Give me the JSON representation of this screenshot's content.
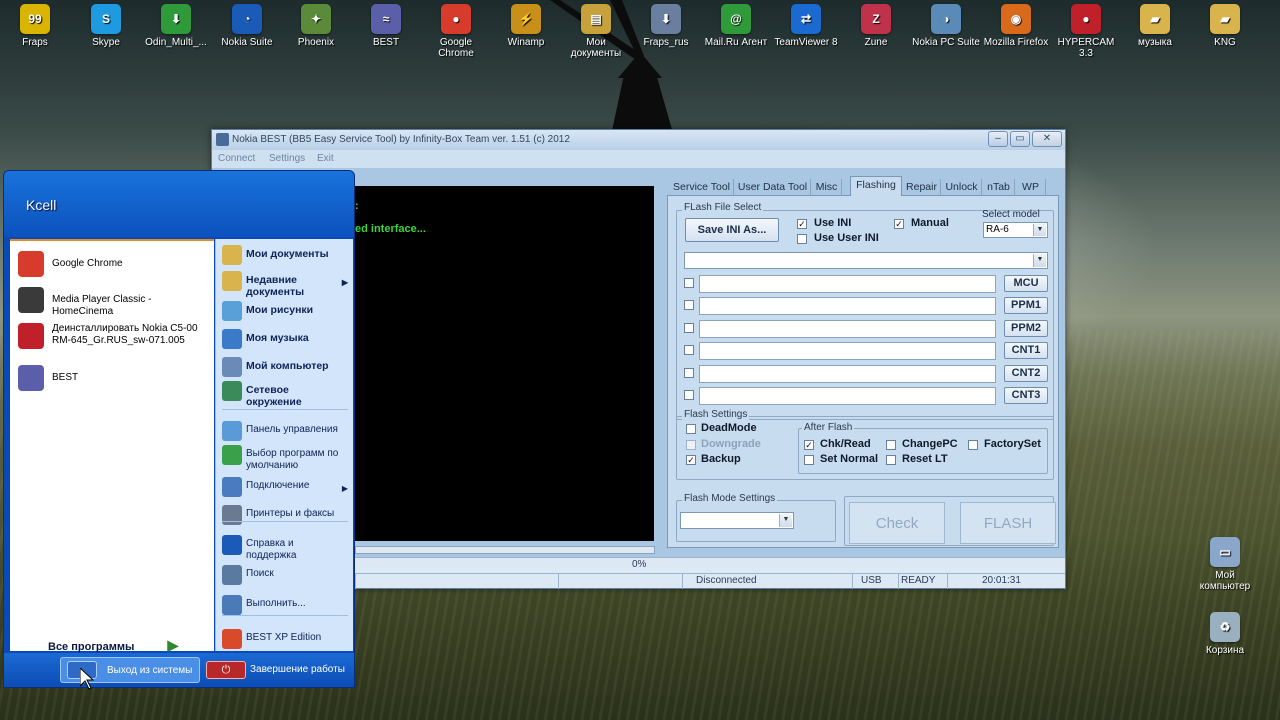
{
  "desktop": {
    "icons": [
      {
        "label": "Fraps",
        "color": "#d9b400",
        "glyph": "99"
      },
      {
        "label": "Skype",
        "color": "#1e9ae0",
        "glyph": "S"
      },
      {
        "label": "Odin_Multi_...",
        "color": "#2e9a3a",
        "glyph": "⬇"
      },
      {
        "label": "Nokia Suite",
        "color": "#1a5bb8",
        "glyph": "◔"
      },
      {
        "label": "Phoenix",
        "color": "#5a8a3a",
        "glyph": "✦"
      },
      {
        "label": "BEST",
        "color": "#5b5ea8",
        "glyph": "≈"
      },
      {
        "label": "Google Chrome",
        "color": "#d63b2c",
        "glyph": "●"
      },
      {
        "label": "Winamp",
        "color": "#c89018",
        "glyph": "⚡"
      },
      {
        "label": "Мои документы",
        "color": "#c7a23c",
        "glyph": "▤"
      },
      {
        "label": "Fraps_rus",
        "color": "#6a7fa0",
        "glyph": "⬇"
      },
      {
        "label": "Mail.Ru Агент",
        "color": "#2f9a3a",
        "glyph": "@"
      },
      {
        "label": "TeamViewer 8",
        "color": "#1a6ad2",
        "glyph": "⇄"
      },
      {
        "label": "Zune",
        "color": "#c0324a",
        "glyph": "Z"
      },
      {
        "label": "Nokia PC Suite",
        "color": "#5a8ab8",
        "glyph": "◑"
      },
      {
        "label": "Mozilla Firefox",
        "color": "#d96a1c",
        "glyph": "◉"
      },
      {
        "label": "HYPERCAM 3.3",
        "color": "#c0202a",
        "glyph": "●"
      },
      {
        "label": "музыка",
        "color": "#d9b44c",
        "glyph": "▰"
      },
      {
        "label": "KNG",
        "color": "#d9b44c",
        "glyph": "▰"
      }
    ],
    "right_icons": [
      {
        "label": "Мой компьютер",
        "color": "#8aa6c8",
        "glyph": "▭"
      },
      {
        "label": "Корзина",
        "color": "#9ab0c0",
        "glyph": "♻"
      }
    ]
  },
  "best_window": {
    "title": "Nokia BEST (BB5 Easy Service Tool) by Infinity-Box Team ver. 1.51 (c) 2012",
    "menu": [
      "Connect",
      "Settings",
      "Exit"
    ],
    "console_lines": [
      ":",
      "ed interface..."
    ],
    "progress_text": "0%",
    "progress_value": 0,
    "status": {
      "connection": "Disconnected",
      "port": "USB",
      "state": "READY",
      "time": "20:01:31"
    },
    "tabs": [
      "Service Tool",
      "User Data Tool",
      "Misc",
      "Flashing",
      "Repair",
      "Unlock",
      "nTab",
      "WP"
    ],
    "active_tab": "Flashing",
    "flash_file_select": {
      "group_label": "FLash File Select",
      "save_btn": "Save INI As...",
      "use_ini": "Use INI",
      "use_ini_checked": true,
      "use_user_ini": "Use User INI",
      "use_user_ini_checked": false,
      "manual": "Manual",
      "manual_checked": true,
      "select_model_label": "Select model",
      "model_value": "RA-6",
      "file_rows": [
        "MCU",
        "PPM1",
        "PPM2",
        "CNT1",
        "CNT2",
        "CNT3"
      ]
    },
    "flash_settings": {
      "group_label": "Flash Settings",
      "deadmode": "DeadMode",
      "downgrade": "Downgrade",
      "backup": "Backup",
      "backup_checked": true,
      "after_flash_label": "After Flash",
      "chk_read": "Chk/Read",
      "chk_read_checked": true,
      "set_normal": "Set Normal",
      "change_pc": "ChangePC",
      "reset_lt": "Reset LT",
      "factory_set": "FactorySet"
    },
    "flash_mode": {
      "group_label": "Flash Mode Settings",
      "value": ""
    },
    "check_btn": "Check",
    "flash_btn": "FLASH"
  },
  "start_menu": {
    "user": "Kcell",
    "pinned": [
      {
        "label": "Google Chrome",
        "color": "#d63b2c"
      },
      {
        "label": "Media Player Classic - HomeCinema",
        "color": "#3a3a3a"
      },
      {
        "label": "Деинсталлировать Nokia C5-00 RM-645_Gr.RUS_sw-071.005",
        "color": "#c0202a"
      },
      {
        "label": "BEST",
        "color": "#5b5ea8"
      }
    ],
    "all_programs": "Все программы",
    "right_items": [
      {
        "label": "Мои документы",
        "bold": true,
        "color": "#d9b44c"
      },
      {
        "label": "Недавние документы",
        "bold": true,
        "color": "#d9b44c",
        "arrow": true
      },
      {
        "label": "Мои рисунки",
        "bold": true,
        "color": "#5aa0d8"
      },
      {
        "label": "Моя музыка",
        "bold": true,
        "color": "#3a7ac8"
      },
      {
        "label": "Мой компьютер",
        "bold": true,
        "color": "#6a8ab8"
      },
      {
        "label": "Сетевое окружение",
        "bold": true,
        "color": "#3a8a5a"
      },
      {
        "label": "Панель управления",
        "bold": false,
        "color": "#5a9ad8"
      },
      {
        "label": "Выбор программ по умолчанию",
        "bold": false,
        "color": "#3aa04a"
      },
      {
        "label": "Подключение",
        "bold": false,
        "color": "#4a7ac0",
        "arrow": true
      },
      {
        "label": "Принтеры и факсы",
        "bold": false,
        "color": "#6a7a90"
      },
      {
        "label": "Справка и поддержка",
        "bold": false,
        "color": "#1a5ab8"
      },
      {
        "label": "Поиск",
        "bold": false,
        "color": "#5a7aa0"
      },
      {
        "label": "Выполнить...",
        "bold": false,
        "color": "#4a7ab8"
      },
      {
        "label": "BEST XP Edition",
        "bold": false,
        "color": "#d84a2a"
      }
    ],
    "logoff": "Выход из системы",
    "shutdown": "Завершение работы"
  }
}
